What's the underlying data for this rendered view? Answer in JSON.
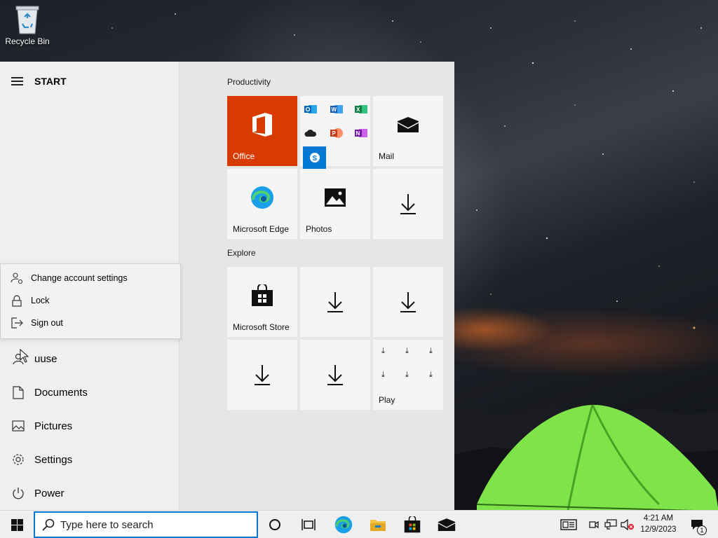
{
  "desktop": {
    "icons": [
      {
        "label": "Recycle Bin",
        "icon": "recycle-bin-icon"
      }
    ]
  },
  "start_menu": {
    "header": {
      "title": "START",
      "icon": "hamburger-menu-icon"
    },
    "account_menu": [
      {
        "label": "Change account settings",
        "icon": "account-settings-icon"
      },
      {
        "label": "Lock",
        "icon": "lock-icon"
      },
      {
        "label": "Sign out",
        "icon": "sign-out-icon"
      }
    ],
    "rail": [
      {
        "label": "uuse",
        "icon": "user-icon"
      },
      {
        "label": "Documents",
        "icon": "document-icon"
      },
      {
        "label": "Pictures",
        "icon": "pictures-icon"
      },
      {
        "label": "Settings",
        "icon": "gear-icon"
      },
      {
        "label": "Power",
        "icon": "power-icon"
      }
    ],
    "groups": [
      {
        "label": "Productivity"
      },
      {
        "label": "Explore"
      }
    ],
    "tiles": {
      "office": {
        "label": "Office",
        "icon": "office-icon",
        "color": "#d83b01"
      },
      "office_apps": {
        "icons": [
          "outlook-icon",
          "word-icon",
          "excel-icon",
          "onedrive-icon",
          "powerpoint-icon",
          "onenote-icon",
          "skype-icon"
        ]
      },
      "mail": {
        "label": "Mail",
        "icon": "mail-icon"
      },
      "edge": {
        "label": "Microsoft Edge",
        "icon": "edge-icon"
      },
      "photos": {
        "label": "Photos",
        "icon": "photos-icon"
      },
      "download1": {
        "icon": "download-arrow-icon"
      },
      "store": {
        "label": "Microsoft Store",
        "icon": "store-icon"
      },
      "download2": {
        "icon": "download-arrow-icon"
      },
      "download3": {
        "icon": "download-arrow-icon"
      },
      "download4": {
        "icon": "download-arrow-icon"
      },
      "download5": {
        "icon": "download-arrow-icon"
      },
      "play": {
        "label": "Play",
        "icon": "download-arrow-icon"
      }
    }
  },
  "taskbar": {
    "search": {
      "placeholder": "Type here to search",
      "value": ""
    },
    "pinned": [
      "cortana-icon",
      "task-view-icon",
      "edge-icon",
      "file-explorer-icon",
      "store-icon",
      "mail-icon"
    ],
    "tray": [
      "news-icon",
      "meet-now-icon",
      "network-icon",
      "volume-muted-icon"
    ],
    "clock": {
      "time": "4:21 AM",
      "date": "12/9/2023"
    },
    "notifications": {
      "icon": "action-center-icon",
      "count": "1"
    }
  },
  "colors": {
    "accent": "#0078d7",
    "office": "#d83b01",
    "tile_bg": "#f5f5f5"
  }
}
